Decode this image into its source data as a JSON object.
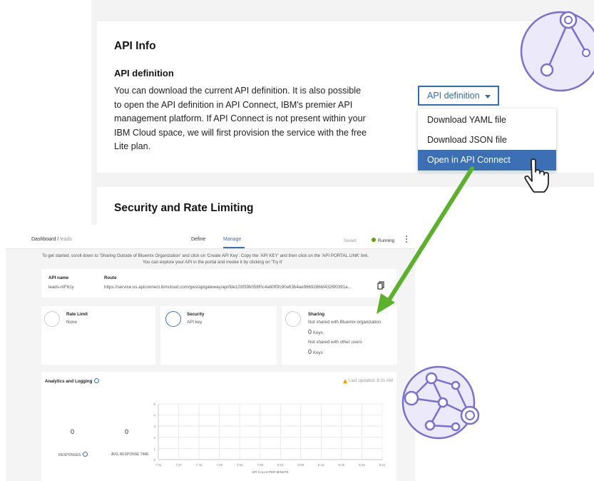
{
  "api_info": {
    "title": "API Info",
    "definition_heading": "API definition",
    "description": "You can download the current API definition. It is also possible to open the API definition in API Connect, IBM's premier API management platform. If API Connect is not present within your IBM Cloud space, we will first provision the service with the free Lite plan.",
    "definition_button": "API definition",
    "menu": [
      {
        "label": "Download YAML file"
      },
      {
        "label": "Download JSON file"
      },
      {
        "label": "Open in API Connect"
      }
    ]
  },
  "security_section": {
    "title": "Security and Rate Limiting"
  },
  "dashboard": {
    "breadcrumb_root": "Dashboard /",
    "breadcrumb_current": "leads",
    "tabs": [
      "Define",
      "Manage"
    ],
    "status_saved": "Saved",
    "status_running": "Running",
    "intro_line1": "To get started, scroll down to 'Sharing Outside of Bluemix Organization' and click on 'Create API Key'. Copy the 'API KEY' and then click on the 'API PORTAL LINK' link.",
    "intro_line2": "You can explore your API in the portal and invoke it by clicking on 'Try it'",
    "api_name_label": "API name",
    "api_name_value": "leads-ntF61y",
    "route_label": "Route",
    "route_value": "https://service.us.apiconnect.ibmcloud.com/gws/apigateway/api/fde103f39b058f0c4a60f0fc90e63b4ae9669286bf4326f0391a...",
    "rate_limit": {
      "title": "Rate Limit",
      "value": "None"
    },
    "security": {
      "title": "Security",
      "value": "API key"
    },
    "sharing": {
      "title": "Sharing",
      "line1": "Not shared with Bluemix organization",
      "count1": "0",
      "keys1": "Keys",
      "line2": "Not shared with other users",
      "count2": "0",
      "keys2": "Keys"
    },
    "analytics": {
      "title": "Analytics and Logging",
      "last_updated": "Last updated: 8:31 AM",
      "responses_value": "0",
      "responses_label": "RESPONSES",
      "avg_value": "0",
      "avg_label": "AVG RESPONSE TIME",
      "x_axis_label": "API CALLS PER MINUTE"
    }
  },
  "chart_data": {
    "type": "line",
    "xlabel": "API CALLS PER MINUTE",
    "ylabel": "",
    "x": [
      "7:31",
      "7:37",
      "7:42",
      "7:48",
      "7:53",
      "7:58",
      "8:04",
      "8:09",
      "8:15",
      "8:20",
      "8:26",
      "8:31"
    ],
    "y_ticks": [
      0,
      1,
      2,
      3,
      4,
      5
    ],
    "ylim": [
      0,
      5
    ],
    "series": [],
    "grid": true
  },
  "colors": {
    "accent_blue": "#2f6db5",
    "menu_active": "#3c6fb3",
    "arrow_green": "#5bb12c",
    "circle_purple": "#7b6fd0",
    "circle_fill": "#ece9fb",
    "running_green": "#5aa700"
  }
}
